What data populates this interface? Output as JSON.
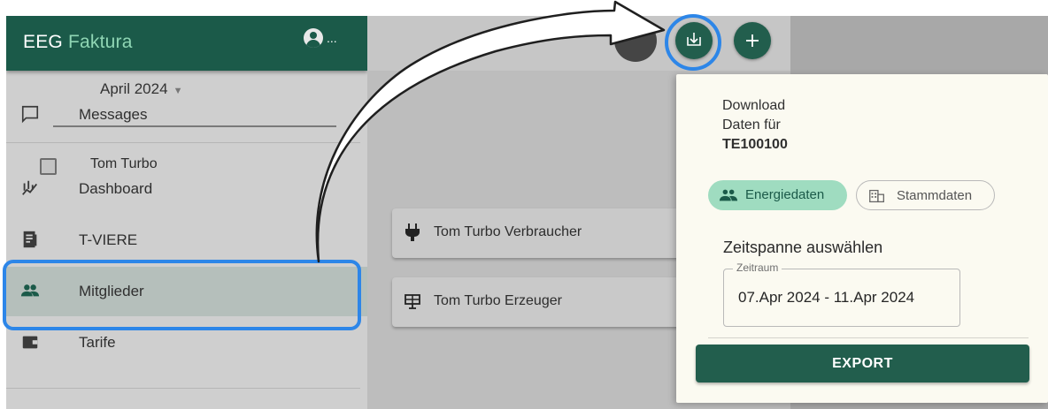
{
  "app": {
    "title_prefix": "EEG",
    "title_accent": "Faktura",
    "user_menu": "..."
  },
  "sidebar": {
    "items": [
      {
        "label": "Messages",
        "icon": "message-icon"
      },
      {
        "label": "Dashboard",
        "icon": "chart-icon"
      },
      {
        "label": "T-VIERE",
        "icon": "document-icon"
      },
      {
        "label": "Mitglieder",
        "icon": "group-icon",
        "selected": true
      },
      {
        "label": "Tarife",
        "icon": "wallet-icon"
      }
    ]
  },
  "main": {
    "month": "April 2024",
    "member": "Tom Turbo",
    "meters": [
      {
        "label": "Tom Turbo Verbraucher",
        "icon": "plug-icon"
      },
      {
        "label": "Tom Turbo Erzeuger",
        "icon": "solar-panel-icon"
      }
    ]
  },
  "toolbar": {
    "download_icon": "download-icon",
    "add_icon": "plus-icon"
  },
  "panel": {
    "line1": "Download",
    "line2": "Daten für",
    "community_id": "TE100100",
    "chips": {
      "energy": "Energiedaten",
      "master": "Stammdaten"
    },
    "section_title": "Zeitspanne auswählen",
    "field_label": "Zeitraum",
    "field_value": "07.Apr 2024 - 11.Apr 2024",
    "export_label": "EXPORT"
  },
  "colors": {
    "brand": "#1b5a49",
    "accent": "#9fdcc0",
    "highlight": "#2d86e8"
  }
}
